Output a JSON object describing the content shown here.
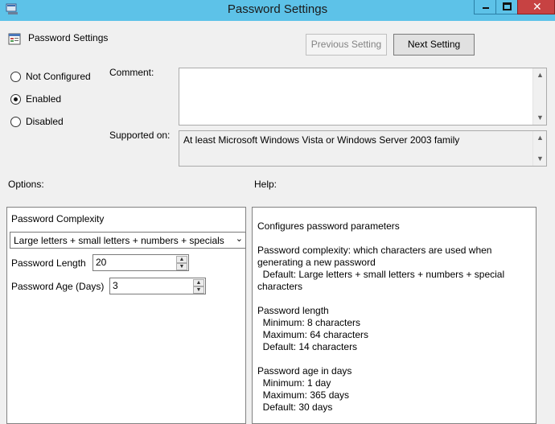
{
  "window": {
    "title": "Password Settings"
  },
  "header": {
    "policy_name": "Password Settings",
    "prev_label": "Previous Setting",
    "next_label": "Next Setting"
  },
  "state": {
    "options": [
      {
        "label": "Not Configured",
        "selected": false
      },
      {
        "label": "Enabled",
        "selected": true
      },
      {
        "label": "Disabled",
        "selected": false
      }
    ]
  },
  "comment": {
    "label": "Comment:",
    "value": ""
  },
  "supported": {
    "label": "Supported on:",
    "value": "At least Microsoft Windows Vista or Windows Server 2003 family"
  },
  "options_panel": {
    "label": "Options:",
    "complexity_label": "Password Complexity",
    "complexity_value": "Large letters + small letters + numbers + specials",
    "length_label": "Password Length",
    "length_value": "20",
    "age_label": "Password Age (Days)",
    "age_value": "3"
  },
  "help_panel": {
    "label": "Help:",
    "lines": [
      "Configures password parameters",
      "",
      "Password complexity: which characters are used when",
      "generating a new password",
      "  Default: Large letters + small letters + numbers + special",
      "characters",
      "",
      "Password length",
      "  Minimum: 8 characters",
      "  Maximum: 64 characters",
      "  Default: 14 characters",
      "",
      "Password age in days",
      "  Minimum: 1 day",
      "  Maximum: 365 days",
      "  Default: 30 days"
    ]
  },
  "colors": {
    "titlebar": "#5dc2e8",
    "close_button": "#c74242",
    "window_bg": "#f0f0f0"
  }
}
